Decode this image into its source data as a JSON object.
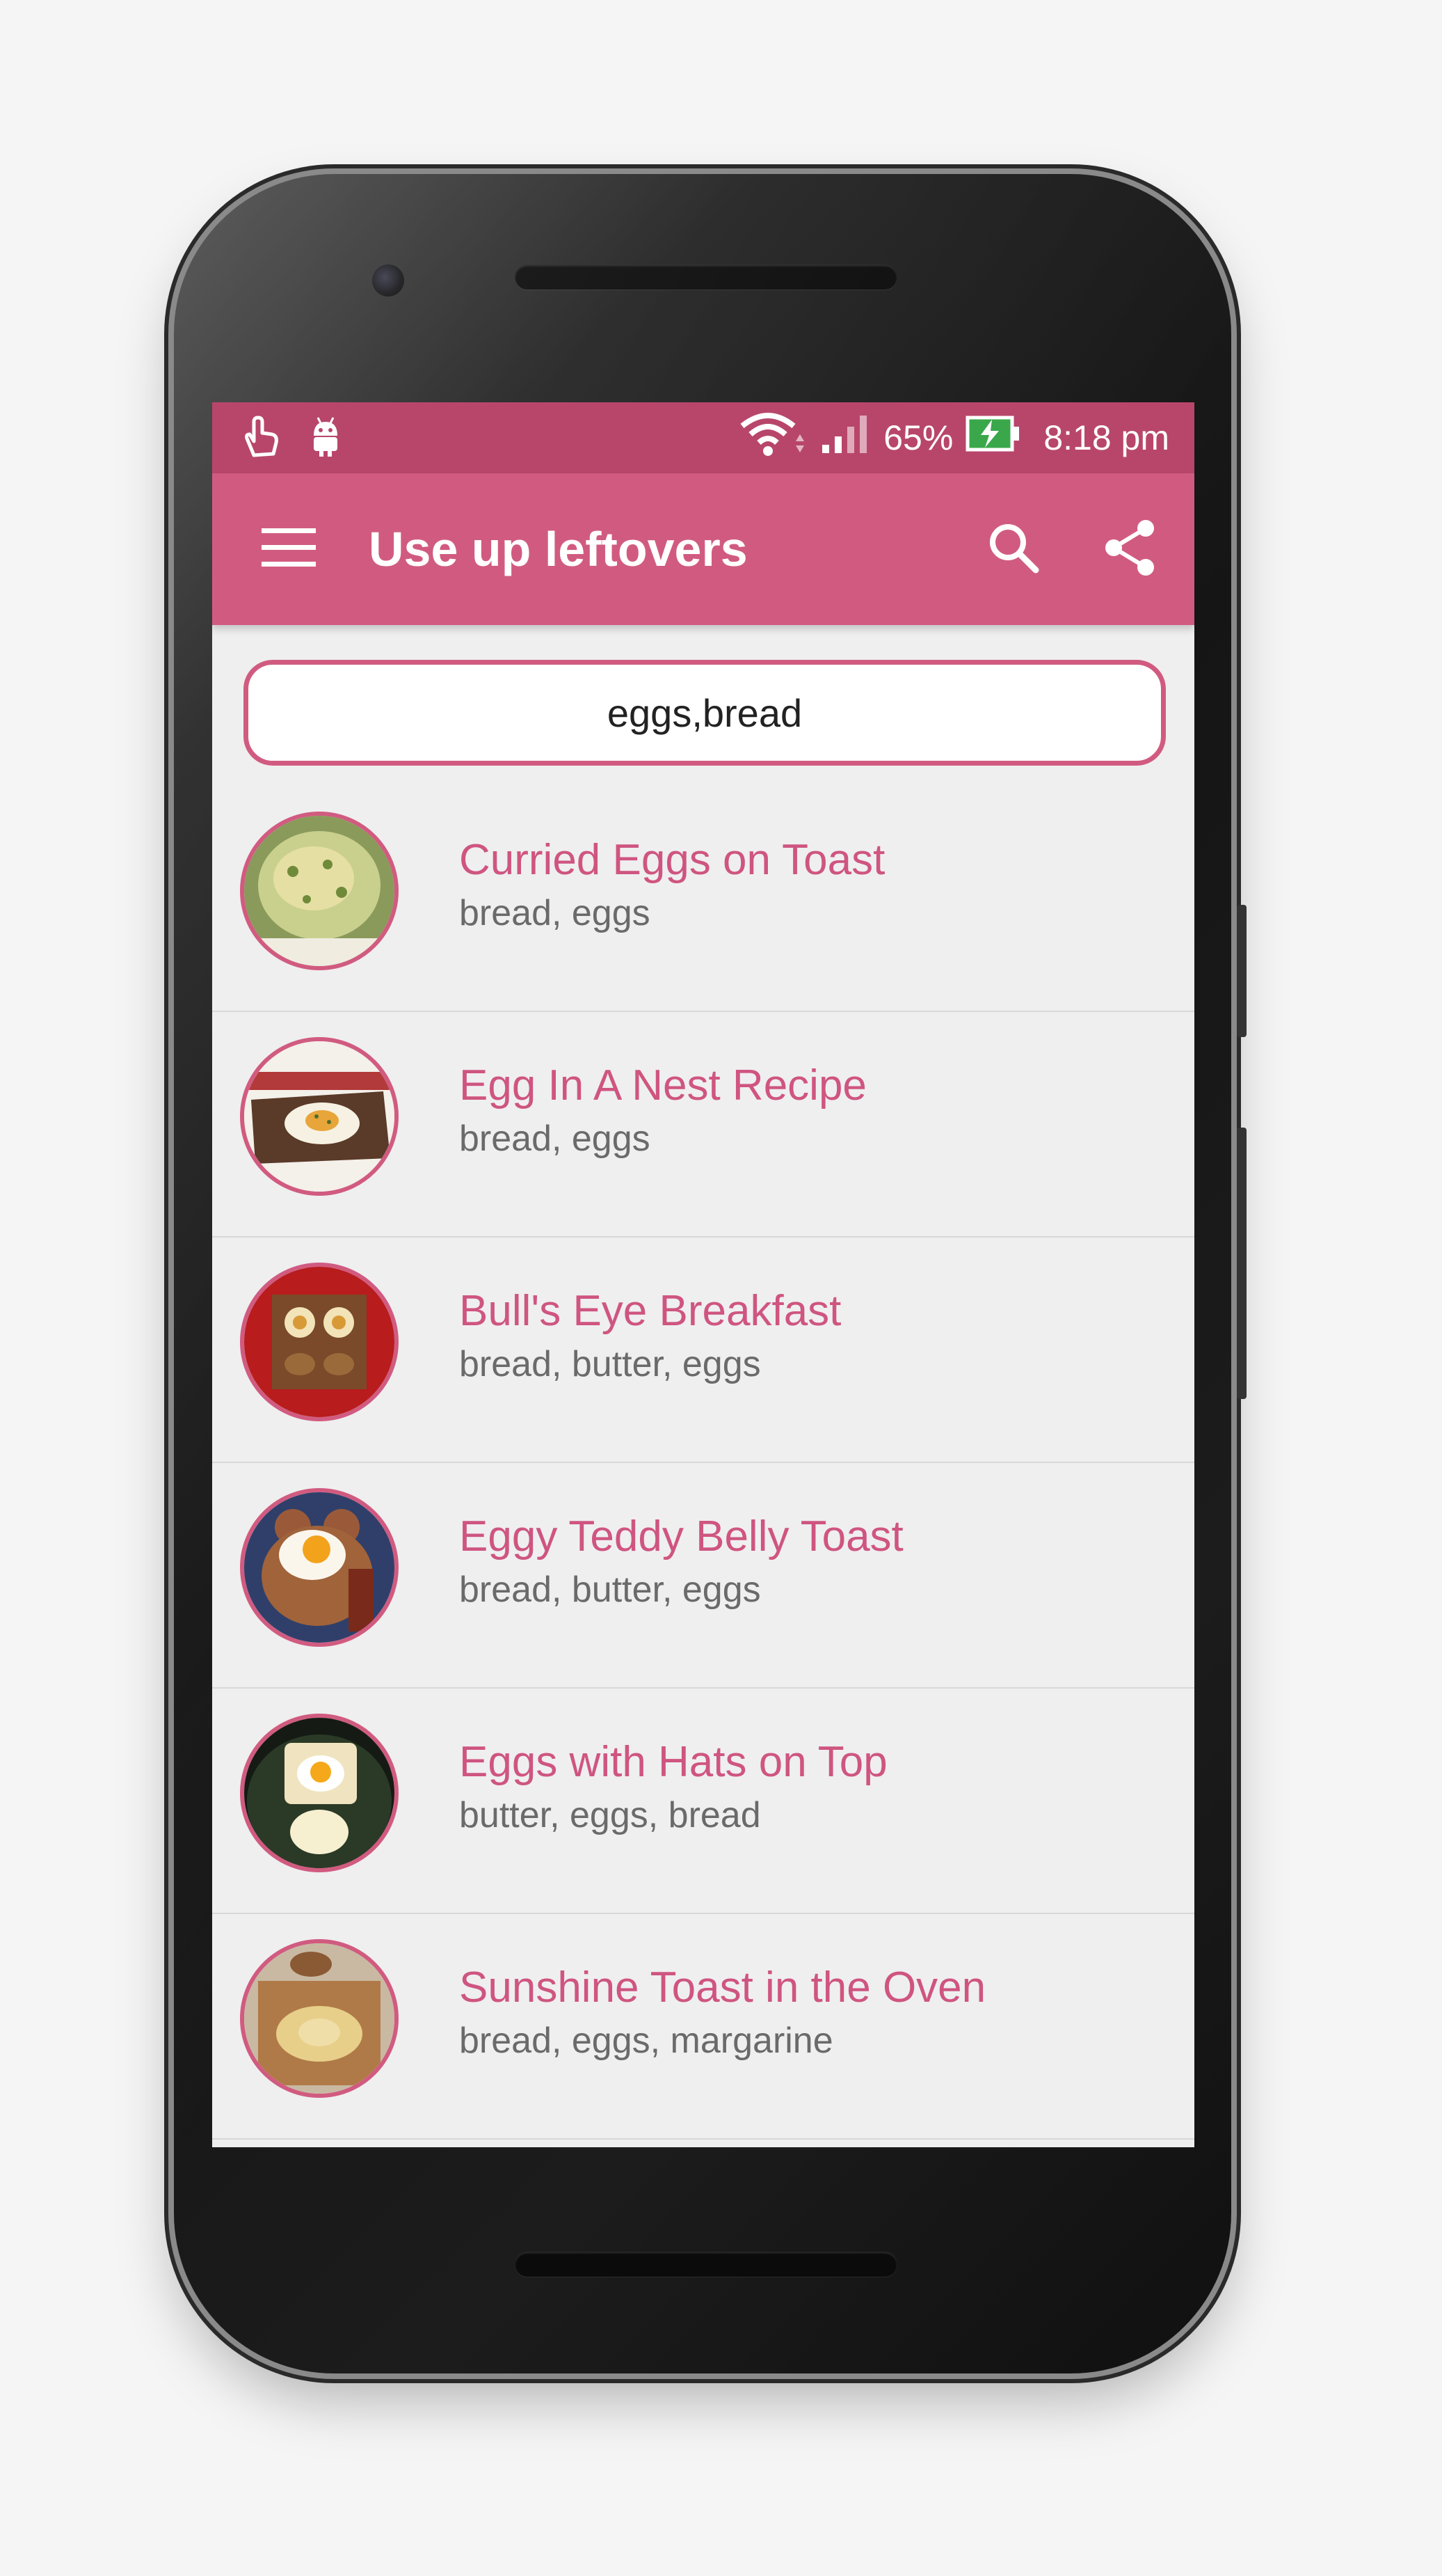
{
  "status_bar": {
    "battery": "65%",
    "time": "8:18 pm"
  },
  "app_bar": {
    "title": "Use up leftovers"
  },
  "search": {
    "value": "eggs,bread"
  },
  "recipes": [
    {
      "title": "Curried Eggs on Toast",
      "ingredients": "bread, eggs"
    },
    {
      "title": "Egg In A Nest Recipe",
      "ingredients": "bread, eggs"
    },
    {
      "title": "Bull's Eye Breakfast",
      "ingredients": "bread, butter, eggs"
    },
    {
      "title": "Eggy Teddy Belly Toast",
      "ingredients": "bread, butter, eggs"
    },
    {
      "title": "Eggs with Hats on Top",
      "ingredients": "butter, eggs, bread"
    },
    {
      "title": "Sunshine Toast in the Oven",
      "ingredients": "bread, eggs, margarine"
    }
  ],
  "colors": {
    "primary": "#d15b80",
    "status_bar": "#b8466b",
    "background": "#efefef"
  }
}
